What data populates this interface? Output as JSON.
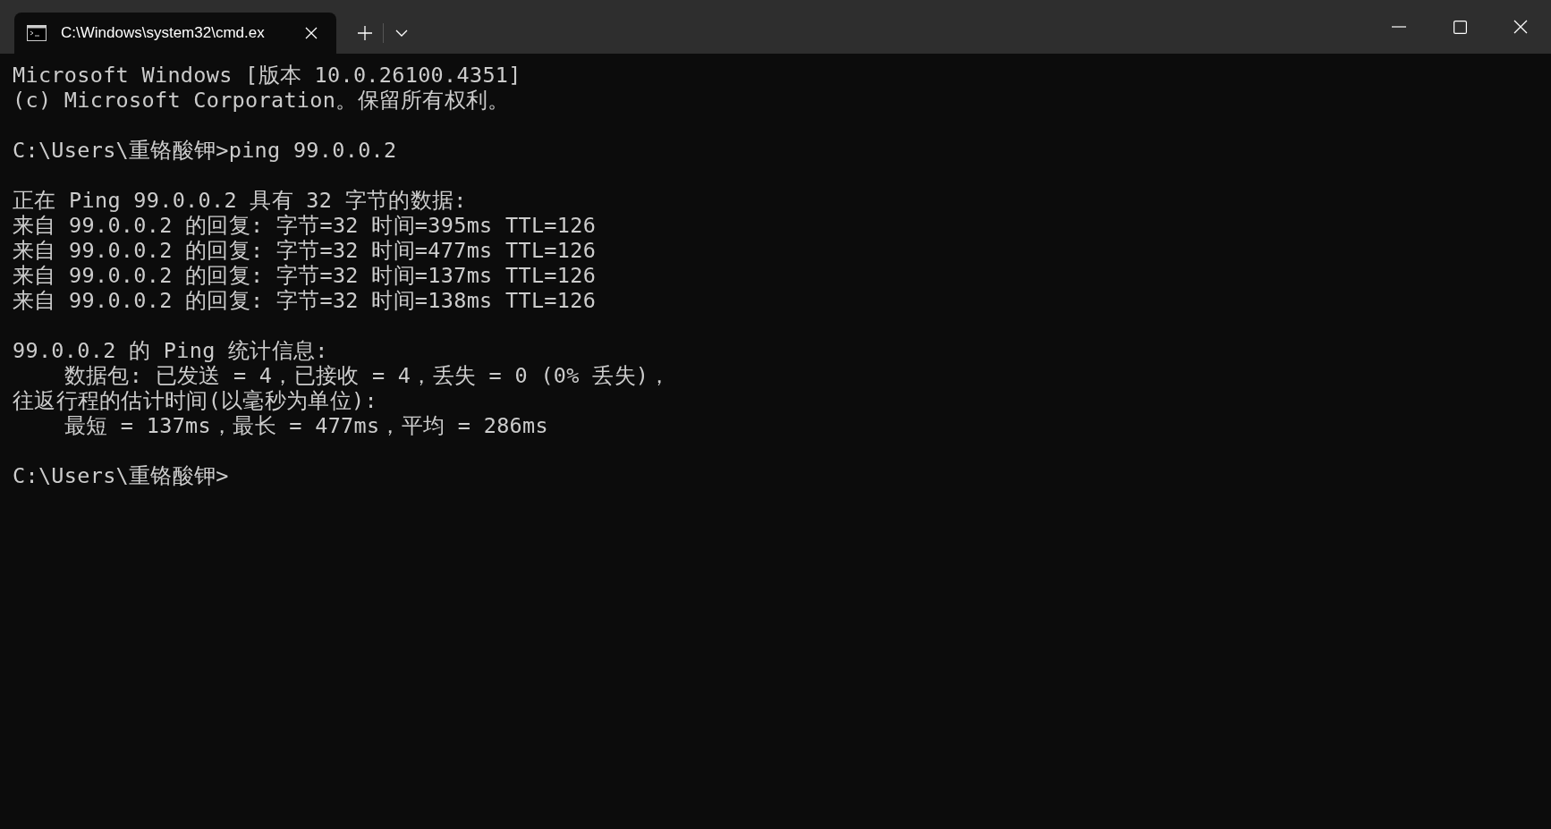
{
  "tab": {
    "title": "C:\\Windows\\system32\\cmd.ex",
    "selected": true
  },
  "console": {
    "blocks": [
      [
        "Microsoft Windows [版本 10.0.26100.4351]",
        "(c) Microsoft Corporation。保留所有权利。"
      ],
      [
        "C:\\Users\\重铬酸钾>ping 99.0.0.2"
      ],
      [
        "正在 Ping 99.0.0.2 具有 32 字节的数据:",
        "来自 99.0.0.2 的回复: 字节=32 时间=395ms TTL=126",
        "来自 99.0.0.2 的回复: 字节=32 时间=477ms TTL=126",
        "来自 99.0.0.2 的回复: 字节=32 时间=137ms TTL=126",
        "来自 99.0.0.2 的回复: 字节=32 时间=138ms TTL=126"
      ],
      [
        "99.0.0.2 的 Ping 统计信息:",
        "    数据包: 已发送 = 4，已接收 = 4，丢失 = 0 (0% 丢失)，",
        "往返行程的估计时间(以毫秒为单位):",
        "    最短 = 137ms，最长 = 477ms，平均 = 286ms"
      ],
      [
        "C:\\Users\\重铬酸钾>"
      ]
    ]
  }
}
